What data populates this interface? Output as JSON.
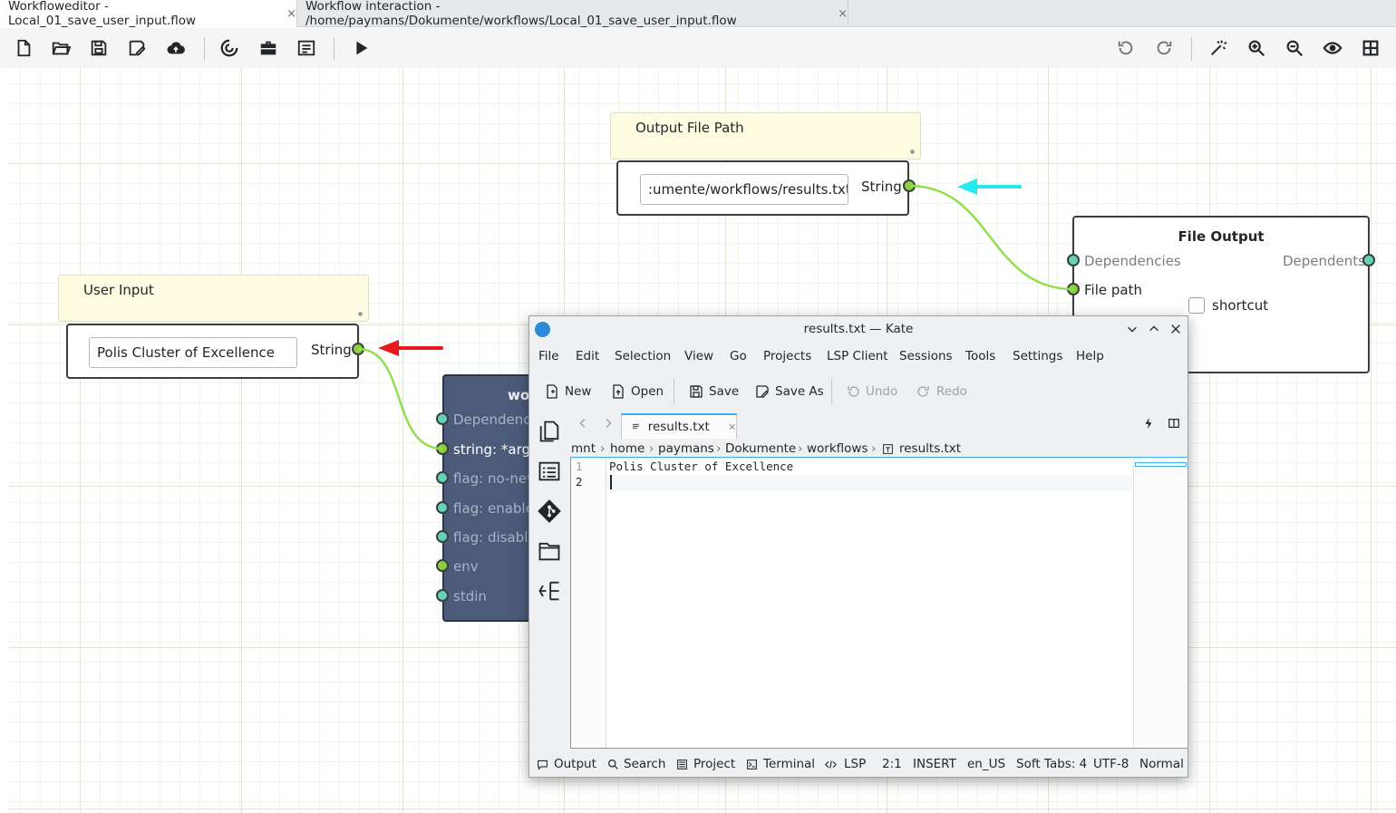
{
  "tabs": [
    {
      "label": "Workfloweditor - Local_01_save_user_input.flow",
      "close": "×"
    },
    {
      "label": "Workflow interaction - /home/paymans/Dokumente/workflows/Local_01_save_user_input.flow",
      "close": "×"
    }
  ],
  "icons": {
    "toolbar_left": [
      "new-file-icon",
      "open-folder-icon",
      "save-icon",
      "save-as-icon",
      "cloud-upload-icon",
      "reload-icon",
      "toolbox-icon",
      "list-icon",
      "run-icon"
    ],
    "toolbar_right": [
      "undo-icon",
      "redo-icon",
      "magic-wand-icon",
      "zoom-in-icon",
      "zoom-out-icon",
      "eye-icon",
      "grid-icon"
    ]
  },
  "colors": {
    "wire": "#90e04e",
    "arrow_red": "#e8181e",
    "arrow_cyan": "#26e8ef",
    "node_dark": "#4c5b79",
    "accent": "#3daee9"
  },
  "nodes": {
    "output_note": {
      "title": "Output File Path"
    },
    "output_path": {
      "value": ":umente/workflows/results.txt",
      "port": "String"
    },
    "user_note": {
      "title": "User Input"
    },
    "user_input": {
      "value": "Polis Cluster of Excellence",
      "port": "String"
    },
    "file_output": {
      "title": "File Output",
      "in1": "Dependencies",
      "out1": "Dependents",
      "in2": "File path",
      "checkbox": "shortcut"
    },
    "workflow": {
      "title": "wo",
      "ports": [
        "Dependenc",
        "string: *arg",
        "flag: no-new",
        "flag: enable",
        "flag: disable",
        "env",
        "stdin"
      ]
    }
  },
  "kate": {
    "title": "results.txt — Kate",
    "menu": [
      "File",
      "Edit",
      "Selection",
      "View",
      "Go",
      "Projects",
      "LSP Client",
      "Sessions",
      "Tools",
      "Settings",
      "Help"
    ],
    "toolbar": {
      "new": "New",
      "open": "Open",
      "save": "Save",
      "save_as": "Save As",
      "undo": "Undo",
      "redo": "Redo"
    },
    "doc_tab": "results.txt",
    "breadcrumbs": [
      "mnt",
      "home",
      "paymans",
      "Dokumente",
      "workflows",
      "results.txt"
    ],
    "lines": [
      "Polis Cluster of Excellence",
      ""
    ],
    "line_numbers": [
      "1",
      "2"
    ],
    "status": {
      "output": "Output",
      "search": "Search",
      "project": "Project",
      "terminal": "Terminal",
      "lsp": "LSP",
      "position": "2:1",
      "mode": "INSERT",
      "lang": "en_US",
      "tabs": "Soft Tabs: 4",
      "encoding": "UTF-8",
      "input_mode": "Normal"
    }
  }
}
